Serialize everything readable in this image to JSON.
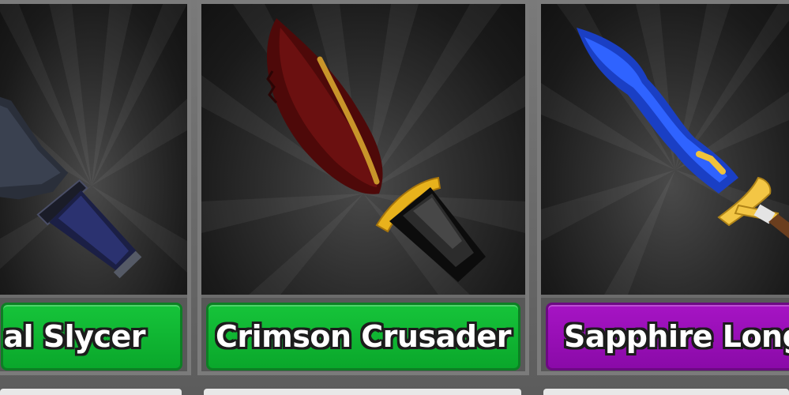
{
  "cards": [
    {
      "name": "Coal Slycer",
      "label": "oal Slycer",
      "label_color": "green",
      "weapon_icon": "dark-knife-icon"
    },
    {
      "name": "Crimson Crusader",
      "label": "Crimson Crusader",
      "label_color": "green",
      "weapon_icon": "crimson-knife-icon"
    },
    {
      "name": "Sapphire Longsword",
      "label": "Sapphire Longsw",
      "label_color": "purple",
      "weapon_icon": "sapphire-sword-icon"
    }
  ],
  "colors": {
    "common_green": "#0fb832",
    "rare_purple": "#9a10b8",
    "crimson_blade": "#5a0c0c",
    "gold_guard": "#e8b21c",
    "sapphire_blade": "#1f4fd8"
  }
}
